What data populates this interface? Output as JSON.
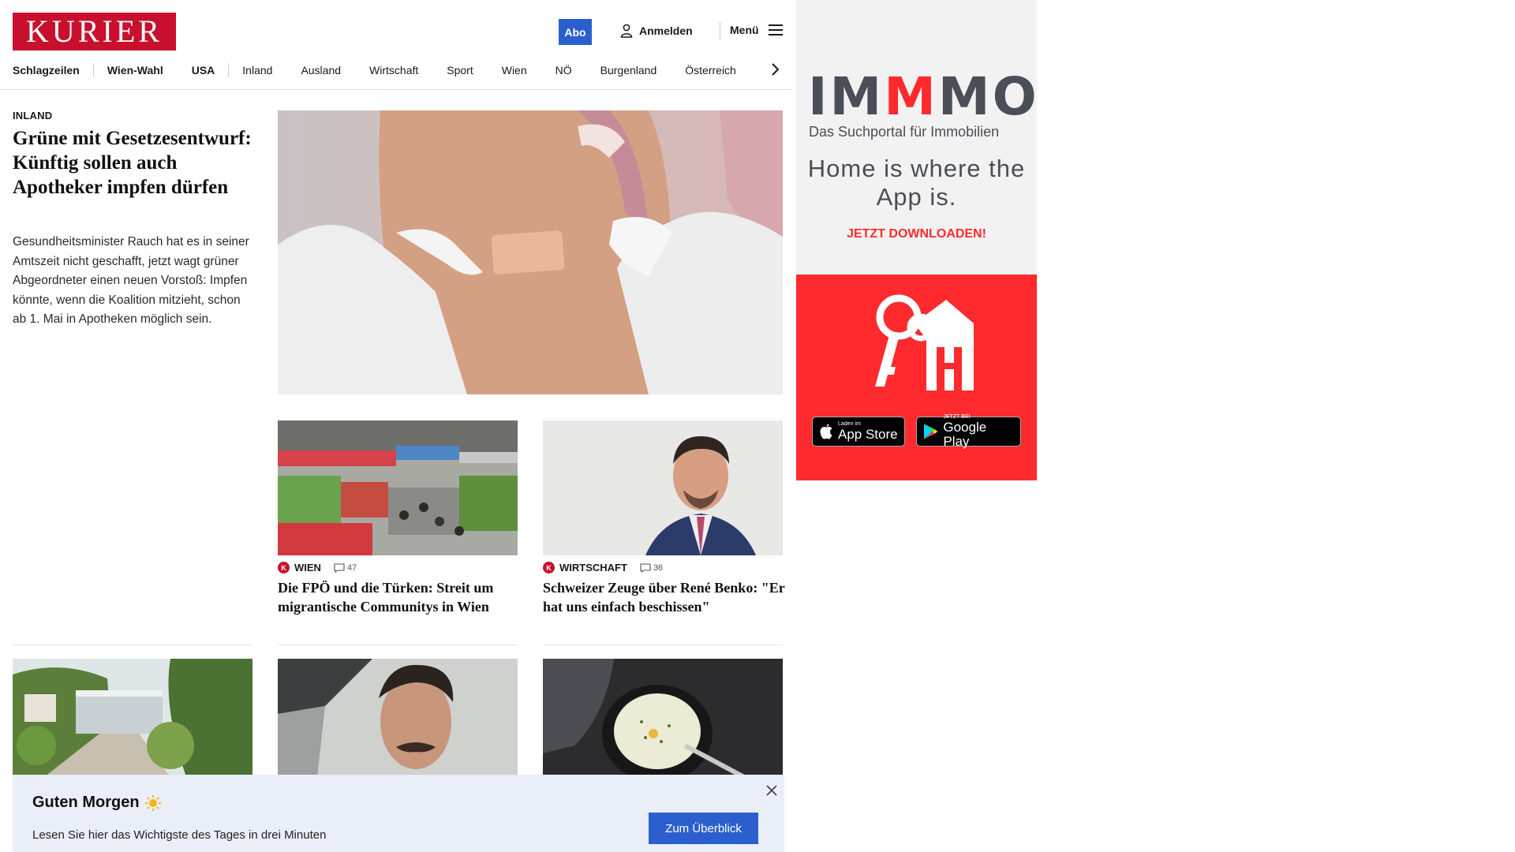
{
  "header": {
    "logo": "KURIER",
    "abo": "Abo",
    "login": "Anmelden",
    "menu": "Menü"
  },
  "nav": {
    "items": [
      "Schlagzeilen",
      "Wien-Wahl",
      "USA",
      "Inland",
      "Ausland",
      "Wirtschaft",
      "Sport",
      "Wien",
      "NÖ",
      "Burgenland",
      "Österreich"
    ]
  },
  "lead": {
    "kicker": "INLAND",
    "title": "Grüne mit Gesetzesentwurf: Künftig sollen auch Apotheker impfen dürfen",
    "teaser": "Gesundheitsminister Rauch hat es in seiner Amtszeit nicht geschafft, jetzt wagt grüner Abgeordneter einen neuen Vorstoß: Impfen könnte, wenn die Koalition mitzieht, schon ab 1. Mai in Apotheken möglich sein."
  },
  "cards": [
    {
      "section": "WIEN",
      "comments": "47",
      "title": "Die FPÖ und die Türken: Streit um migrantische Communitys in Wien"
    },
    {
      "section": "WIRTSCHAFT",
      "comments": "36",
      "title": "Schweizer Zeuge über René Benko: \"Er hat uns einfach beschissen\""
    }
  ],
  "banner": {
    "title": "Guten Morgen",
    "text": "Lesen Sie hier das Wichtigste des Tages in drei Minuten",
    "button": "Zum Überblick"
  },
  "ad": {
    "logo_part1": "IM",
    "logo_part2": "M",
    "logo_part3": "MO",
    "subtitle": "Das Suchportal für Immobilien",
    "tagline": "Home is where the App is.",
    "cta": "JETZT DOWNLOADEN!",
    "appstore_small": "Laden im",
    "appstore_big": "App Store",
    "googleplay_small": "JETZT BEI",
    "googleplay_big": "Google Play",
    "colors": {
      "brand_red": "#ff2a2e",
      "brand_gray": "#4a4e57"
    }
  },
  "colors": {
    "kurier_red": "#c8102e",
    "accent_blue": "#2c5fce"
  }
}
